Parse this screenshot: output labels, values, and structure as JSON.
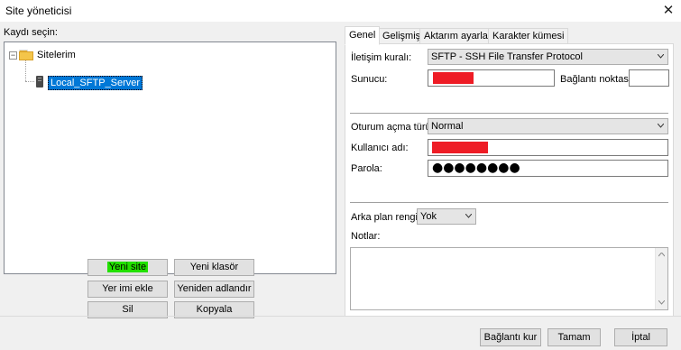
{
  "window": {
    "title": "Site yöneticisi",
    "close_glyph": "✕"
  },
  "left": {
    "select_label": "Kaydı seçin:",
    "tree": {
      "expander_glyph": "−",
      "root_label": "Sitelerim",
      "selected_label": "Local_SFTP_Server"
    },
    "buttons": {
      "new_site": "Yeni site",
      "new_folder": "Yeni klasör",
      "new_bookmark": "Yer imi ekle",
      "rename": "Yeniden adlandır",
      "delete": "Sil",
      "copy": "Kopyala"
    }
  },
  "tabs": [
    "Genel",
    "Gelişmiş",
    "Aktarım ayarları",
    "Karakter kümesi"
  ],
  "general": {
    "protocol_label": "İletişim kuralı:",
    "protocol_value": "SFTP - SSH File Transfer Protocol",
    "host_label": "Sunucu:",
    "host_value": "",
    "port_label": "Bağlantı noktası:",
    "port_value": "",
    "logon_label": "Oturum açma türü:",
    "logon_value": "Normal",
    "user_label": "Kullanıcı adı:",
    "user_value": "",
    "password_label": "Parola:",
    "password_value": "●●●●●●●●",
    "bgcolor_label": "Arka plan rengi:",
    "bgcolor_value": "Yok",
    "notes_label": "Notlar:",
    "notes_value": ""
  },
  "footer": {
    "connect": "Bağlantı kur",
    "ok": "Tamam",
    "cancel": "İptal"
  },
  "colors": {
    "selection": "#0078d7",
    "highlight": "#22e000",
    "redaction": "#ee1c25"
  }
}
